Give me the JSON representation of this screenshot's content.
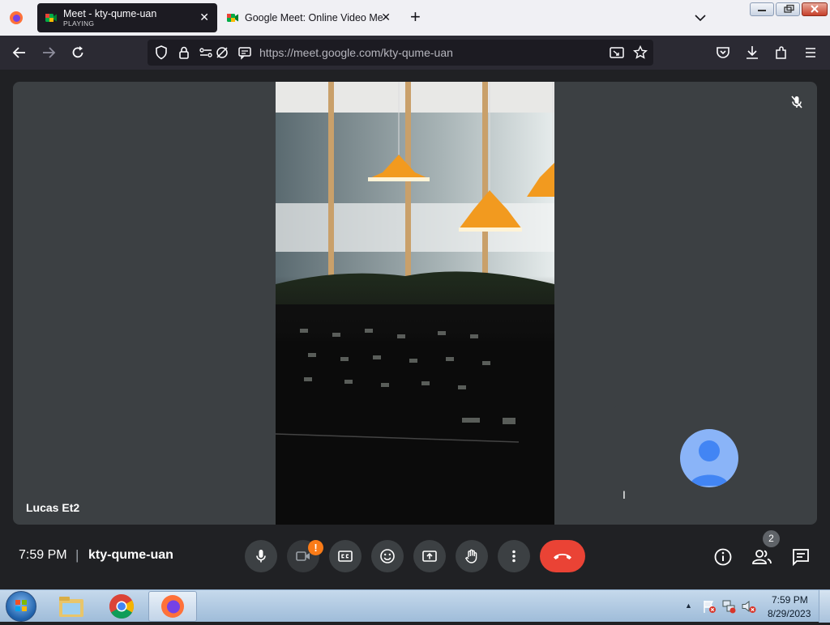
{
  "browser": {
    "tabs": [
      {
        "title": "Meet - kty-qume-uan",
        "status": "PLAYING",
        "active": true
      },
      {
        "title": "Google Meet: Online Video Mee",
        "active": false
      }
    ],
    "new_tab_label": "+",
    "url": "https://meet.google.com/kty-qume-uan"
  },
  "meet": {
    "main_participant_name": "Lucas Et2",
    "self_tile_label": "I",
    "time": "7:59 PM",
    "separator": "|",
    "meeting_code": "kty-qume-uan",
    "camera_alert": "!",
    "participants_count": "2",
    "accent_colors": {
      "end_call": "#ea4335",
      "alert": "#fa7b17",
      "avatar": "#8ab4f8"
    }
  },
  "taskbar": {
    "clock_time": "7:59 PM",
    "clock_date": "8/29/2023"
  }
}
